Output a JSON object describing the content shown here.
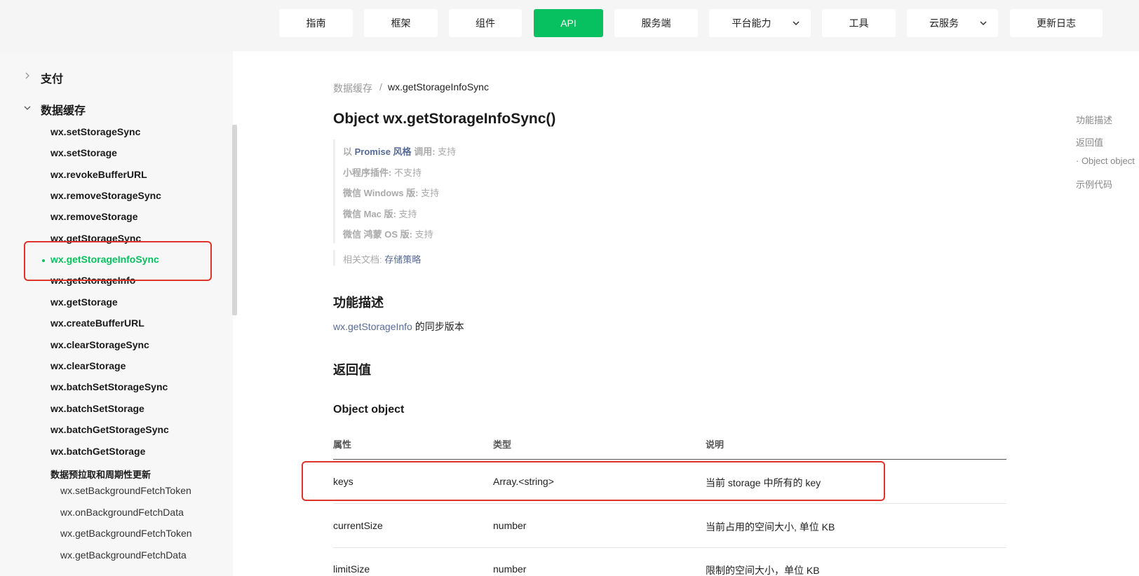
{
  "nav": {
    "items": [
      {
        "label": "指南"
      },
      {
        "label": "框架"
      },
      {
        "label": "组件"
      },
      {
        "label": "API"
      },
      {
        "label": "服务端"
      },
      {
        "label": "平台能力"
      },
      {
        "label": "工具"
      },
      {
        "label": "云服务"
      },
      {
        "label": "更新日志"
      }
    ],
    "active": "API"
  },
  "sidebar": {
    "section_pay": "支付",
    "section_storage": "数据缓存",
    "items": [
      "wx.setStorageSync",
      "wx.setStorage",
      "wx.revokeBufferURL",
      "wx.removeStorageSync",
      "wx.removeStorage",
      "wx.getStorageSync",
      "wx.getStorageInfoSync",
      "wx.getStorageInfo",
      "wx.getStorage",
      "wx.createBufferURL",
      "wx.clearStorageSync",
      "wx.clearStorage",
      "wx.batchSetStorageSync",
      "wx.batchSetStorage",
      "wx.batchGetStorageSync",
      "wx.batchGetStorage"
    ],
    "active_item": "wx.getStorageInfoSync",
    "subgroup_title": "数据预拉取和周期性更新",
    "subgroup_items": [
      "wx.setBackgroundFetchToken",
      "wx.onBackgroundFetchData",
      "wx.getBackgroundFetchToken",
      "wx.getBackgroundFetchData"
    ]
  },
  "breadcrumb": {
    "parent": "数据缓存",
    "separator": "/",
    "current": "wx.getStorageInfoSync"
  },
  "page": {
    "title": "Object wx.getStorageInfoSync()",
    "support": {
      "promise_prefix": "以",
      "promise_link": "Promise 风格",
      "promise_suffix": "调用:",
      "promise_value": "支持",
      "plugin_label": "小程序插件:",
      "plugin_value": "不支持",
      "windows_label": "微信 Windows 版:",
      "windows_value": "支持",
      "mac_label": "微信 Mac 版:",
      "mac_value": "支持",
      "harmony_label": "微信 鸿蒙 OS 版:",
      "harmony_value": "支持"
    },
    "related": {
      "label": "相关文档:",
      "link": "存储策略"
    },
    "func_heading": "功能描述",
    "func_link": "wx.getStorageInfo",
    "func_text": "的同步版本",
    "return_heading": "返回值",
    "object_heading": "Object object",
    "table": {
      "headers": [
        "属性",
        "类型",
        "说明"
      ],
      "rows": [
        {
          "name": "keys",
          "type": "Array.<string>",
          "desc": "当前 storage 中所有的 key"
        },
        {
          "name": "currentSize",
          "type": "number",
          "desc": "当前占用的空间大小, 单位 KB"
        },
        {
          "name": "limitSize",
          "type": "number",
          "desc": "限制的空间大小，单位 KB"
        }
      ]
    }
  },
  "toc": {
    "items": [
      "功能描述",
      "返回值",
      "· Object object",
      "示例代码"
    ]
  },
  "colors": {
    "accent": "#07c160",
    "link": "#576b95",
    "highlight_box": "#e0332b"
  }
}
